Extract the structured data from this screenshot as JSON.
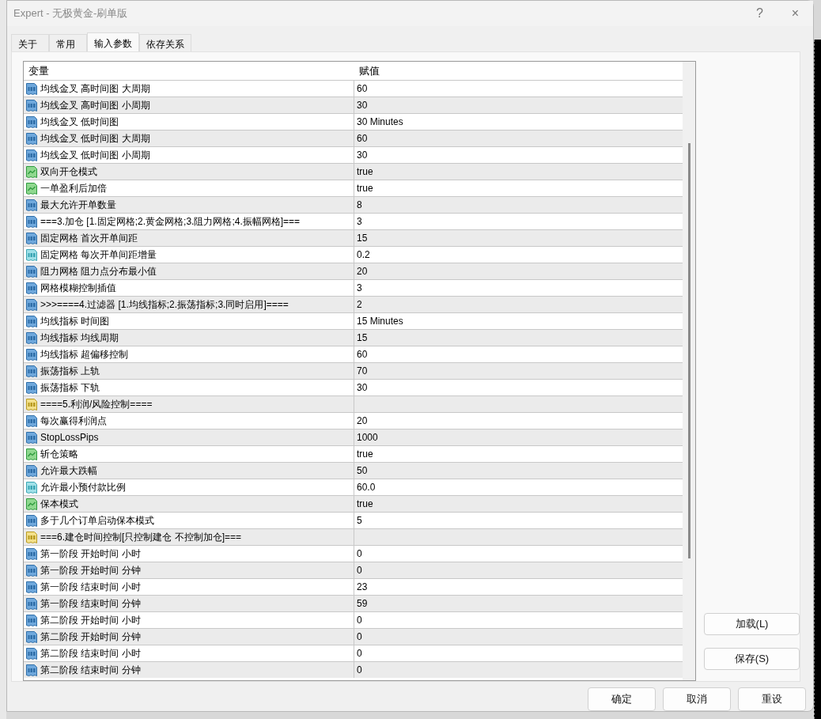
{
  "window": {
    "title": "Expert - 无极黄金-刷单版",
    "help": "?",
    "close": "×"
  },
  "tabs": [
    {
      "label": "关于",
      "selected": false
    },
    {
      "label": "常用",
      "selected": false
    },
    {
      "label": "输入参数",
      "selected": true
    },
    {
      "label": "依存关系",
      "selected": false
    }
  ],
  "table": {
    "columns": [
      "变量",
      "赋值"
    ],
    "rows": [
      {
        "kind": "int",
        "name": "均线金叉 高时间图 大周期",
        "value": "60"
      },
      {
        "kind": "int",
        "name": "均线金叉 高时间图 小周期",
        "value": "30"
      },
      {
        "kind": "int",
        "name": "均线金叉 低时间图",
        "value": "30 Minutes"
      },
      {
        "kind": "int",
        "name": "均线金叉 低时间图 大周期",
        "value": "60"
      },
      {
        "kind": "int",
        "name": "均线金叉 低时间图 小周期",
        "value": "30"
      },
      {
        "kind": "bool",
        "name": "双向开仓模式",
        "value": "true"
      },
      {
        "kind": "bool",
        "name": "一单盈利后加倍",
        "value": "true"
      },
      {
        "kind": "int",
        "name": "最大允许开单数量",
        "value": "8"
      },
      {
        "kind": "int",
        "name": "===3.加仓 [1.固定网格;2.黄金网格;3.阻力网格;4.振幅网格]===",
        "value": "3"
      },
      {
        "kind": "int",
        "name": "固定网格 首次开单间距",
        "value": "15"
      },
      {
        "kind": "double",
        "name": "固定网格 每次开单间距增量",
        "value": "0.2"
      },
      {
        "kind": "int",
        "name": "阻力网格 阻力点分布最小值",
        "value": "20"
      },
      {
        "kind": "int",
        "name": "网格模糊控制插值",
        "value": "3"
      },
      {
        "kind": "int",
        "name": ">>>====4.过滤器 [1.均线指标;2.振荡指标;3.同时启用]====",
        "value": "2"
      },
      {
        "kind": "int",
        "name": "均线指标 时间图",
        "value": "15 Minutes"
      },
      {
        "kind": "int",
        "name": "均线指标 均线周期",
        "value": "15"
      },
      {
        "kind": "int",
        "name": "均线指标 超偏移控制",
        "value": "60"
      },
      {
        "kind": "int",
        "name": "振荡指标 上轨",
        "value": "70"
      },
      {
        "kind": "int",
        "name": "振荡指标 下轨",
        "value": "30"
      },
      {
        "kind": "string",
        "name": "====5.利润/风险控制===="
      },
      {
        "kind": "int",
        "name": "每次赢得利润点",
        "value": "20"
      },
      {
        "kind": "int",
        "name": "StopLossPips",
        "value": "1000"
      },
      {
        "kind": "bool",
        "name": "斩仓策略",
        "value": "true"
      },
      {
        "kind": "int",
        "name": "允许最大跌幅",
        "value": "50"
      },
      {
        "kind": "double",
        "name": "允许最小预付款比例",
        "value": "60.0"
      },
      {
        "kind": "bool",
        "name": "保本模式",
        "value": "true"
      },
      {
        "kind": "int",
        "name": "多于几个订单启动保本模式",
        "value": "5"
      },
      {
        "kind": "string",
        "name": "===6.建仓时间控制[只控制建仓 不控制加仓]==="
      },
      {
        "kind": "int",
        "name": "第一阶段 开始时间 小时",
        "value": "0"
      },
      {
        "kind": "int",
        "name": "第一阶段 开始时间 分钟",
        "value": "0"
      },
      {
        "kind": "int",
        "name": "第一阶段 结束时间 小时",
        "value": "23"
      },
      {
        "kind": "int",
        "name": "第一阶段 结束时间 分钟",
        "value": "59"
      },
      {
        "kind": "int",
        "name": "第二阶段 开始时间 小时",
        "value": "0"
      },
      {
        "kind": "int",
        "name": "第二阶段 开始时间 分钟",
        "value": "0"
      },
      {
        "kind": "int",
        "name": "第二阶段 结束时间 小时",
        "value": "0"
      },
      {
        "kind": "int",
        "name": "第二阶段 结束时间 分钟",
        "value": "0"
      }
    ]
  },
  "side_buttons": [
    "加载(L)",
    "保存(S)"
  ],
  "buttons": [
    "确定",
    "取消",
    "重设"
  ]
}
